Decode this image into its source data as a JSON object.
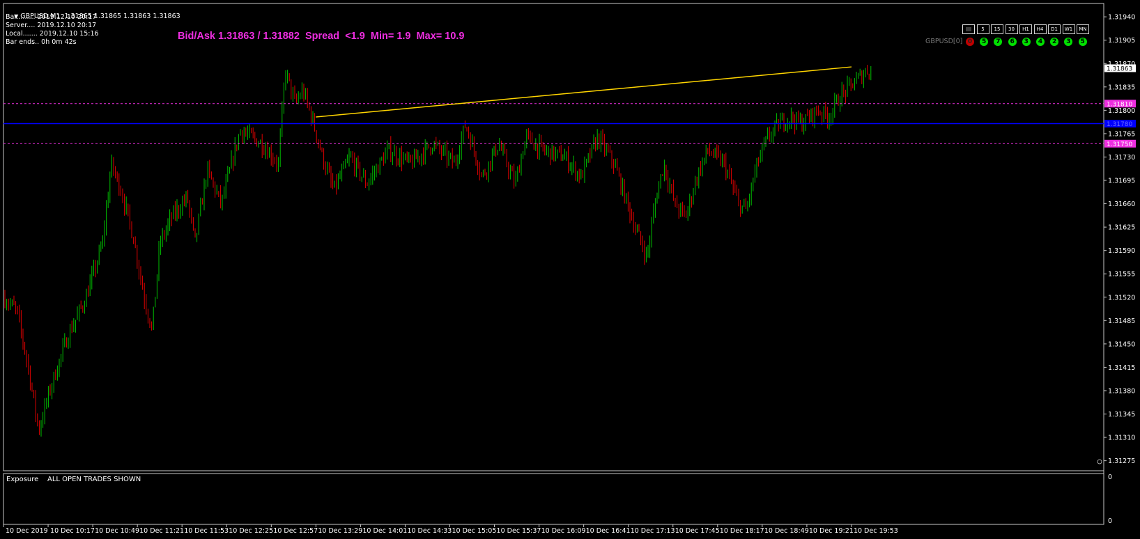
{
  "header": {
    "symbol_line": "GBPUSD,M1  1.31865 1.31865 1.31863 1.31863",
    "bar": "Bar......... 2019.12.10 20:17",
    "server": "Server.... 2019.12.10 20:17",
    "local": "Local....... 2019.12.10 15:16",
    "bar_ends": "Bar ends.. 0h 0m 42s"
  },
  "bidask": "Bid/Ask 1.31863 / 1.31882  Spread  <1.9  Min= 1.9  Max= 10.9",
  "timeframes": [
    "",
    "5",
    "15",
    "30",
    "H1",
    "H4",
    "D1",
    "W1",
    "MN"
  ],
  "signal_panel": {
    "label": "GBPUSD[0]",
    "signals": [
      {
        "v": "0",
        "color": "red"
      },
      {
        "v": "5",
        "color": "green"
      },
      {
        "v": "7",
        "color": "green"
      },
      {
        "v": "6",
        "color": "green"
      },
      {
        "v": "3",
        "color": "green"
      },
      {
        "v": "4",
        "color": "green"
      },
      {
        "v": "2",
        "color": "green"
      },
      {
        "v": "3",
        "color": "green"
      },
      {
        "v": "5",
        "color": "green"
      }
    ]
  },
  "subwindow": {
    "label": "Exposure    ALL OPEN TRADES SHOWN",
    "scale_top": "0",
    "scale_bottom": "0"
  },
  "chart_data": {
    "type": "candlestick",
    "symbol": "GBPUSD",
    "timeframe": "M1",
    "ylim": [
      1.3126,
      1.3196
    ],
    "price_ticks": [
      "1.31940",
      "1.31905",
      "1.31870",
      "1.31835",
      "1.31800",
      "1.31765",
      "1.31730",
      "1.31695",
      "1.31660",
      "1.31625",
      "1.31590",
      "1.31555",
      "1.31520",
      "1.31485",
      "1.31450",
      "1.31415",
      "1.31380",
      "1.31345",
      "1.31310",
      "1.31275"
    ],
    "time_ticks": [
      "10 Dec 2019",
      "10 Dec 10:17",
      "10 Dec 10:49",
      "10 Dec 11:21",
      "10 Dec 11:53",
      "10 Dec 12:25",
      "10 Dec 12:57",
      "10 Dec 13:29",
      "10 Dec 14:01",
      "10 Dec 14:33",
      "10 Dec 15:05",
      "10 Dec 15:37",
      "10 Dec 16:09",
      "10 Dec 16:41",
      "10 Dec 17:13",
      "10 Dec 17:45",
      "10 Dec 18:17",
      "10 Dec 18:49",
      "10 Dec 19:21",
      "10 Dec 19:53"
    ],
    "current_price": "1.31863",
    "levels": [
      {
        "price": 1.3181,
        "label": "1.31810",
        "style": "dashed",
        "color": "#ee2ee0"
      },
      {
        "price": 1.3178,
        "label": "1.31780",
        "style": "solid",
        "color": "#0000ff"
      },
      {
        "price": 1.3175,
        "label": "1.31750",
        "style": "dashed",
        "color": "#ee2ee0"
      }
    ],
    "trendline": {
      "from": {
        "time": "10 Dec 13:29",
        "price": 1.3179
      },
      "to": {
        "time": "10 Dec 19:53",
        "price": 1.31865
      },
      "color": "#ffd500"
    },
    "path_keypoints": [
      [
        0,
        1.3152
      ],
      [
        0.012,
        1.315
      ],
      [
        0.022,
        1.3142
      ],
      [
        0.032,
        1.3132
      ],
      [
        0.042,
        1.3138
      ],
      [
        0.058,
        1.3146
      ],
      [
        0.075,
        1.3152
      ],
      [
        0.09,
        1.316
      ],
      [
        0.098,
        1.3172
      ],
      [
        0.107,
        1.3168
      ],
      [
        0.118,
        1.3161
      ],
      [
        0.128,
        1.3152
      ],
      [
        0.135,
        1.3147
      ],
      [
        0.142,
        1.316
      ],
      [
        0.153,
        1.3164
      ],
      [
        0.167,
        1.3167
      ],
      [
        0.174,
        1.316
      ],
      [
        0.185,
        1.3171
      ],
      [
        0.198,
        1.3166
      ],
      [
        0.215,
        1.3177
      ],
      [
        0.235,
        1.3175
      ],
      [
        0.25,
        1.3172
      ],
      [
        0.256,
        1.3186
      ],
      [
        0.265,
        1.3181
      ],
      [
        0.272,
        1.3183
      ],
      [
        0.28,
        1.3179
      ],
      [
        0.29,
        1.3173
      ],
      [
        0.3,
        1.3168
      ],
      [
        0.315,
        1.3173
      ],
      [
        0.33,
        1.3169
      ],
      [
        0.35,
        1.3174
      ],
      [
        0.37,
        1.3172
      ],
      [
        0.39,
        1.3175
      ],
      [
        0.41,
        1.3172
      ],
      [
        0.42,
        1.3178
      ],
      [
        0.435,
        1.317
      ],
      [
        0.45,
        1.3175
      ],
      [
        0.465,
        1.3169
      ],
      [
        0.475,
        1.3176
      ],
      [
        0.49,
        1.3174
      ],
      [
        0.51,
        1.3173
      ],
      [
        0.525,
        1.317
      ],
      [
        0.54,
        1.3176
      ],
      [
        0.555,
        1.3172
      ],
      [
        0.565,
        1.3167
      ],
      [
        0.575,
        1.3162
      ],
      [
        0.585,
        1.3158
      ],
      [
        0.592,
        1.3166
      ],
      [
        0.6,
        1.3172
      ],
      [
        0.61,
        1.3166
      ],
      [
        0.62,
        1.3164
      ],
      [
        0.63,
        1.317
      ],
      [
        0.64,
        1.3174
      ],
      [
        0.655,
        1.3172
      ],
      [
        0.668,
        1.3166
      ],
      [
        0.675,
        1.3165
      ],
      [
        0.685,
        1.3172
      ],
      [
        0.695,
        1.3176
      ],
      [
        0.705,
        1.3178
      ],
      [
        0.715,
        1.3179
      ],
      [
        0.725,
        1.3178
      ],
      [
        0.74,
        1.318
      ],
      [
        0.75,
        1.3179
      ],
      [
        0.76,
        1.3182
      ],
      [
        0.772,
        1.3184
      ],
      [
        0.785,
        1.3186
      ],
      [
        0.79,
        1.31863
      ]
    ]
  }
}
